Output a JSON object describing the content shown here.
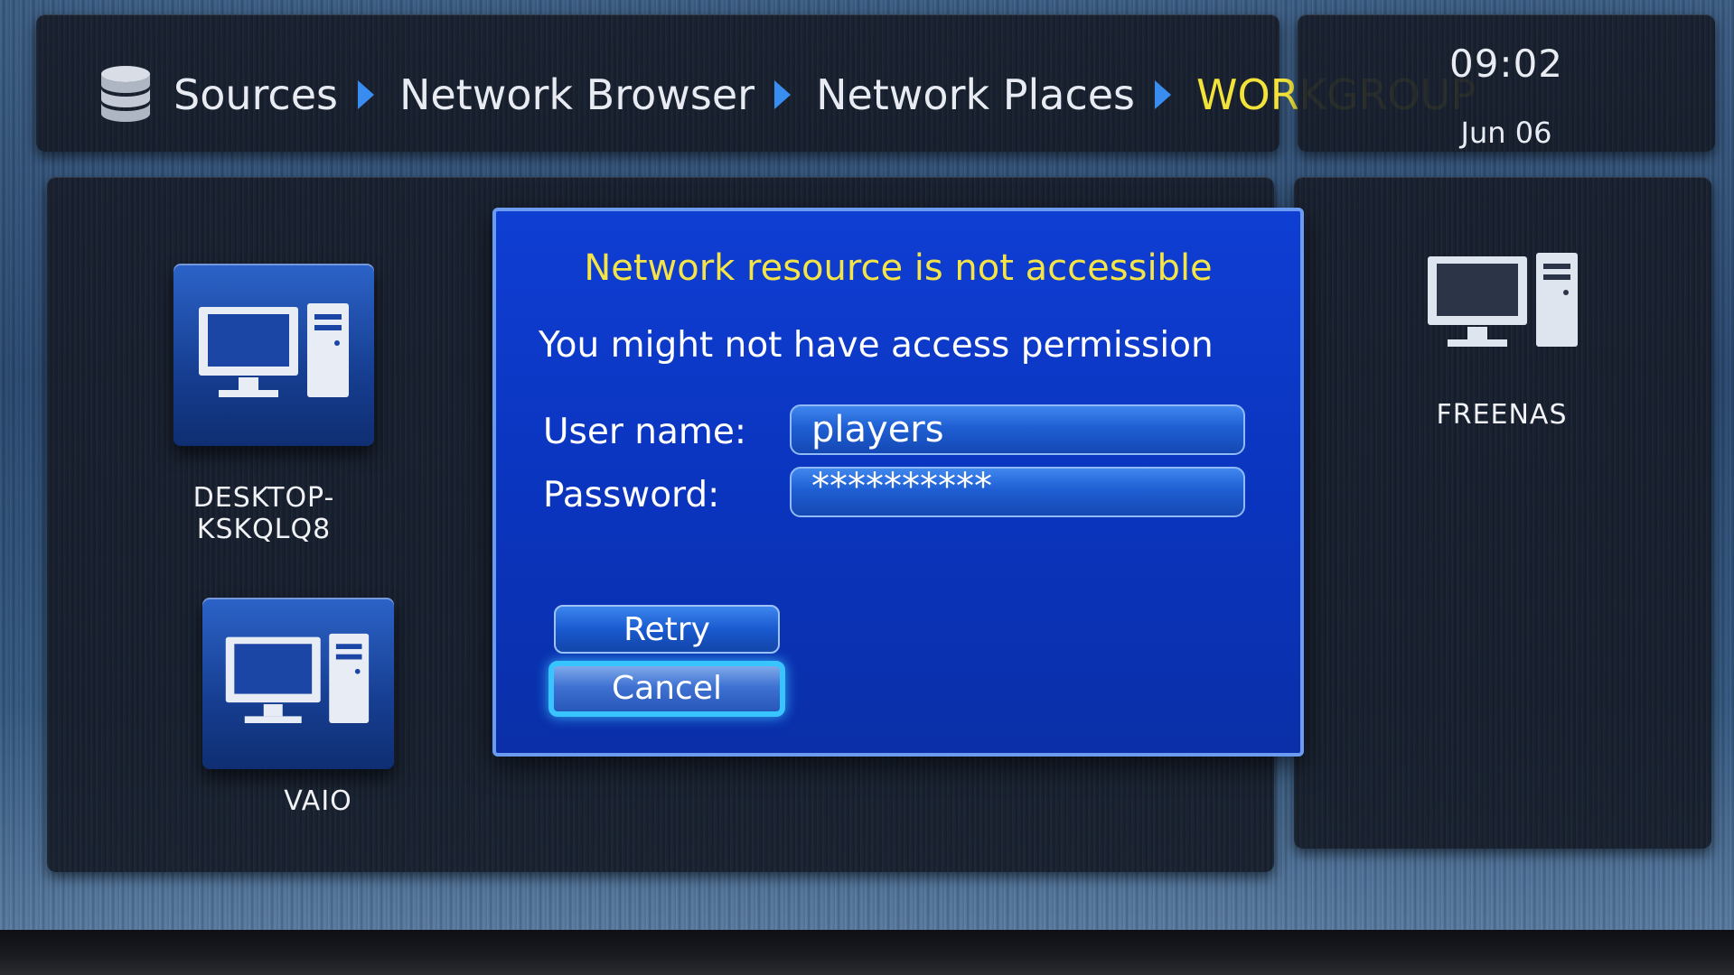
{
  "breadcrumb": {
    "items": [
      "Sources",
      "Network Browser",
      "Network Places"
    ],
    "current": "WORKGROUP",
    "icon": "database-icon"
  },
  "clock": {
    "time": "09:02",
    "date": "Jun 06"
  },
  "devices": [
    {
      "name": "DESKTOP-KSKQLQ8",
      "icon": "computer-icon"
    },
    {
      "name": "VAIO",
      "icon": "computer-icon"
    },
    {
      "name": "FREENAS",
      "icon": "computer-icon"
    }
  ],
  "dialog": {
    "title": "Network resource is not accessible",
    "message": "You might not have access permission",
    "username_label": "User name:",
    "username_value": "players",
    "password_label": "Password:",
    "password_value": "**********",
    "retry_label": "Retry",
    "cancel_label": "Cancel",
    "focused_button": "Cancel"
  },
  "colors": {
    "accent_yellow": "#f4e447",
    "dialog_blue": "#0f3ed3",
    "focus_cyan": "#38c4ff"
  }
}
